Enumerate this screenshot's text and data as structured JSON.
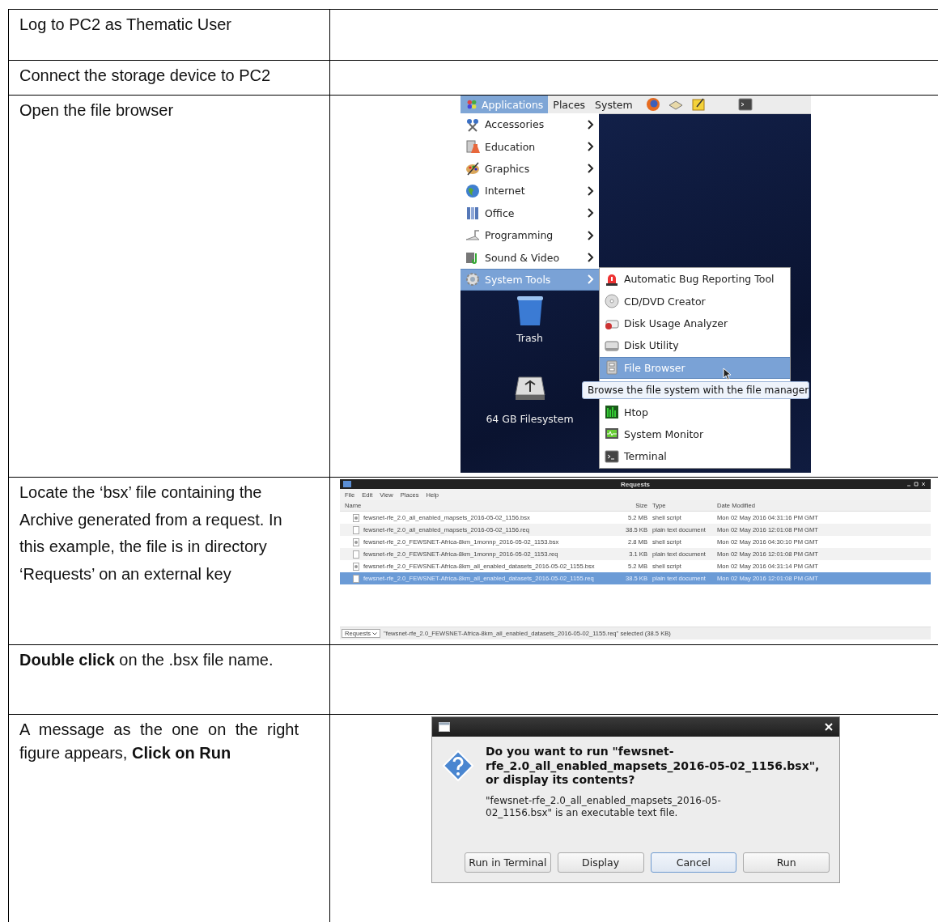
{
  "document_table": {
    "rows": [
      {
        "instruction": "Log to PC2 as Thematic User"
      },
      {
        "instruction": "Connect the storage device to PC2"
      },
      {
        "instruction": "Open the file browser",
        "figure": {
          "kind": "desktop_menu",
          "panel": [
            {
              "label": "Applications",
              "selected": true
            },
            {
              "label": "Places",
              "selected": false
            },
            {
              "label": "System",
              "selected": false
            }
          ],
          "menu": [
            {
              "label": "Accessories",
              "selected": false
            },
            {
              "label": "Education",
              "selected": false
            },
            {
              "label": "Graphics",
              "selected": false
            },
            {
              "label": "Internet",
              "selected": false
            },
            {
              "label": "Office",
              "selected": false
            },
            {
              "label": "Programming",
              "selected": false
            },
            {
              "label": "Sound & Video",
              "selected": false
            },
            {
              "label": "System Tools",
              "selected": true
            }
          ],
          "submenu": [
            {
              "label": "Automatic Bug Reporting Tool",
              "selected": false
            },
            {
              "label": "CD/DVD Creator",
              "selected": false
            },
            {
              "label": "Disk Usage Analyzer",
              "selected": false
            },
            {
              "label": "Disk Utility",
              "selected": false
            },
            {
              "label": "File Browser",
              "selected": true
            },
            {
              "label": "Htop",
              "selected": false
            },
            {
              "label": "System Monitor",
              "selected": false
            },
            {
              "label": "Terminal",
              "selected": false
            }
          ],
          "tooltip": "Browse the file system with the file manager",
          "desktop_icons": [
            {
              "label": "Trash"
            },
            {
              "label": "64 GB Filesystem"
            }
          ]
        }
      },
      {
        "instruction": "Locate the ‘bsx’ file containing the Archive generated from a request. In this example, the file is in directory ‘Requests’ on an external key",
        "figure": {
          "kind": "file_manager",
          "title": "Requests",
          "menu": [
            "File",
            "Edit",
            "View",
            "Places",
            "Help"
          ],
          "columns": [
            "Name",
            "Size",
            "Type",
            "Date Modified"
          ],
          "files": [
            {
              "name": "fewsnet-rfe_2.0_all_enabled_mapsets_2016-05-02_1156.bsx",
              "size": "5.2 MB",
              "type": "shell script",
              "date": "Mon 02 May 2016 04:31:16 PM GMT",
              "kind": "script",
              "selected": false
            },
            {
              "name": "fewsnet-rfe_2.0_all_enabled_mapsets_2016-05-02_1156.req",
              "size": "38.5 KB",
              "type": "plain text document",
              "date": "Mon 02 May 2016 12:01:08 PM GMT",
              "kind": "text",
              "selected": false
            },
            {
              "name": "fewsnet-rfe_2.0_FEWSNET-Africa-8km_1monnp_2016-05-02_1153.bsx",
              "size": "2.8 MB",
              "type": "shell script",
              "date": "Mon 02 May 2016 04:30:10 PM GMT",
              "kind": "script",
              "selected": false
            },
            {
              "name": "fewsnet-rfe_2.0_FEWSNET-Africa-8km_1monnp_2016-05-02_1153.req",
              "size": "3.1 KB",
              "type": "plain text document",
              "date": "Mon 02 May 2016 12:01:08 PM GMT",
              "kind": "text",
              "selected": false
            },
            {
              "name": "fewsnet-rfe_2.0_FEWSNET-Africa-8km_all_enabled_datasets_2016-05-02_1155.bsx",
              "size": "5.2 MB",
              "type": "shell script",
              "date": "Mon 02 May 2016 04:31:14 PM GMT",
              "kind": "script",
              "selected": false
            },
            {
              "name": "fewsnet-rfe_2.0_FEWSNET-Africa-8km_all_enabled_datasets_2016-05-02_1155.req",
              "size": "38.5 KB",
              "type": "plain text document",
              "date": "Mon 02 May 2016 12:01:08 PM GMT",
              "kind": "text",
              "selected": true
            }
          ],
          "location": "Requests",
          "status": "\"fewsnet-rfe_2.0_FEWSNET-Africa-8km_all_enabled_datasets_2016-05-02_1155.req\" selected (38.5 KB)"
        }
      },
      {
        "instruction": "**Double click** on the .bsx file name."
      },
      {
        "instruction": "A message as the one on the right figure appears, **Click on Run**",
        "figure": {
          "kind": "dialog",
          "heading": "Do you want to run \"fewsnet-rfe_2.0_all_enabled_mapsets_2016-05-02_1156.bsx\", or display its contents?",
          "message": "\"fewsnet-rfe_2.0_all_enabled_mapsets_2016-05-02_1156.bsx\" is an executable text file.",
          "buttons": [
            {
              "label": "Run in Terminal",
              "focused": false
            },
            {
              "label": "Display",
              "focused": false
            },
            {
              "label": "Cancel",
              "focused": true
            },
            {
              "label": "Run",
              "focused": false
            }
          ]
        }
      }
    ]
  }
}
